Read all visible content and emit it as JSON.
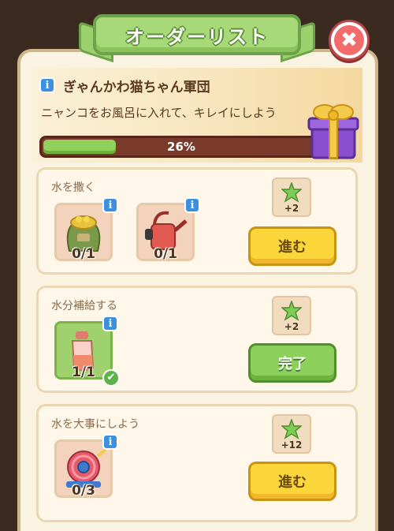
{
  "header_banner": {
    "title": "オーダーリスト"
  },
  "close": {
    "icon": "close-icon",
    "glyph": "✖"
  },
  "event": {
    "title": "ぎゃんかわ猫ちゃん軍団",
    "description": "ニャンコをお風呂に入れて、キレイにしよう",
    "progress_text": "26%",
    "progress_value": 0.26,
    "info_glyph": "i"
  },
  "colors": {
    "banner_green": "#a8d978",
    "progress_fill": "#8fd15a",
    "progress_track": "#7a3a2a",
    "button_go": "#fbd63a",
    "button_done": "#8ad05a",
    "close_red": "#f36b6b"
  },
  "tasks": [
    {
      "title": "水を撒く",
      "items": [
        {
          "icon": "seed-sack-icon",
          "count": "0/1",
          "done": false
        },
        {
          "icon": "watering-can-icon",
          "count": "0/1",
          "done": false
        }
      ],
      "reward": "+2",
      "button": "進む",
      "button_state": "go"
    },
    {
      "title": "水分補給する",
      "items": [
        {
          "icon": "water-bottle-icon",
          "count": "1/1",
          "done": true
        }
      ],
      "reward": "+2",
      "button": "完了",
      "button_state": "done"
    },
    {
      "title": "水を大事にしよう",
      "items": [
        {
          "icon": "hose-reel-icon",
          "count": "0/3",
          "done": false
        }
      ],
      "reward": "+12",
      "button": "進む",
      "button_state": "go"
    }
  ]
}
